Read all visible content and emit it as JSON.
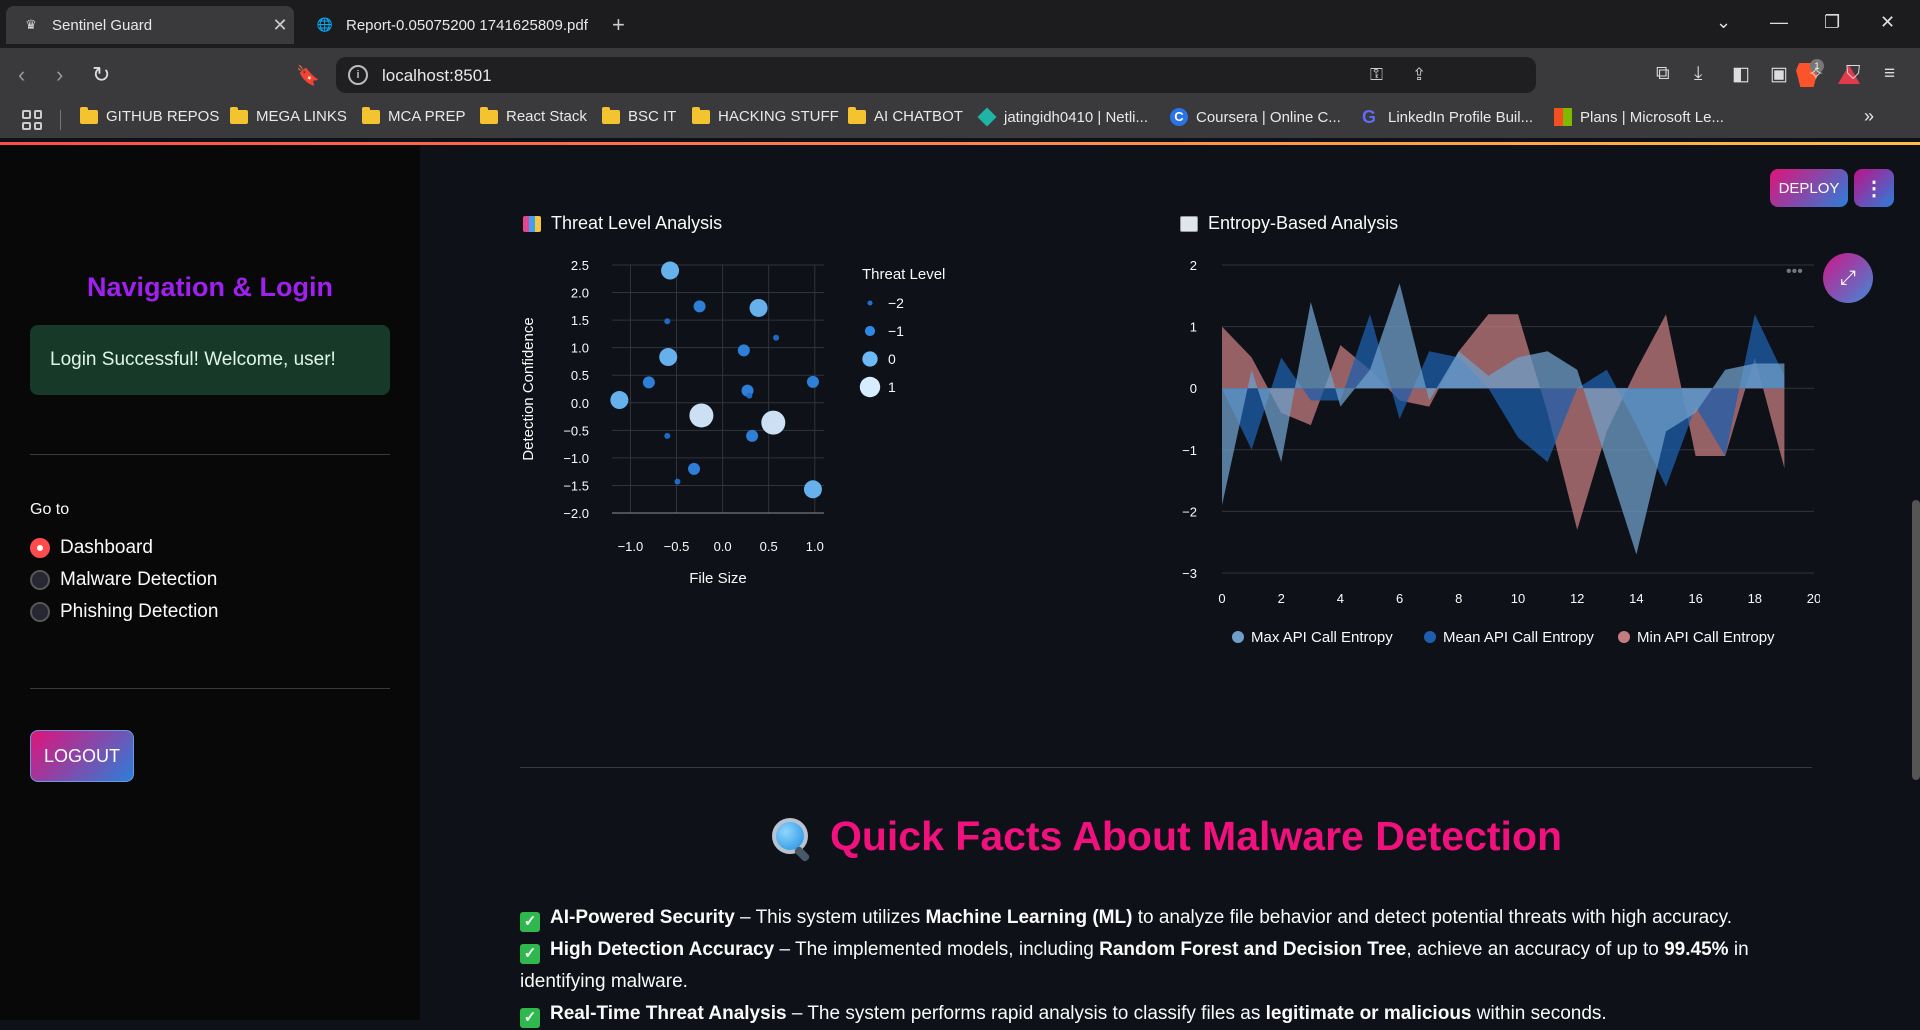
{
  "browser": {
    "tabs": [
      {
        "title": "Sentinel Guard",
        "icon": "crown-icon"
      },
      {
        "title": "Report-0.05075200 1741625809.pdf",
        "icon": "globe-icon"
      }
    ],
    "url": "localhost:8501",
    "brave_badge": "1",
    "bookmarks": [
      {
        "label": "GITHUB REPOS",
        "icon": "folder-icon"
      },
      {
        "label": "MEGA LINKS",
        "icon": "folder-icon"
      },
      {
        "label": "MCA PREP",
        "icon": "folder-icon"
      },
      {
        "label": "React Stack",
        "icon": "folder-icon"
      },
      {
        "label": "BSC IT",
        "icon": "folder-icon"
      },
      {
        "label": "HACKING STUFF",
        "icon": "folder-icon"
      },
      {
        "label": "AI CHATBOT",
        "icon": "folder-icon"
      },
      {
        "label": "jatingidh0410 | Netli...",
        "icon": "netlify-icon"
      },
      {
        "label": "Coursera | Online C...",
        "icon": "coursera-icon"
      },
      {
        "label": "LinkedIn Profile Buil...",
        "icon": "linkedin-builder-icon"
      },
      {
        "label": "Plans | Microsoft Le...",
        "icon": "microsoft-icon"
      }
    ]
  },
  "sidebar": {
    "title": "Navigation & Login",
    "login_message": "Login Successful! Welcome, user!",
    "goto_label": "Go to",
    "options": [
      "Dashboard",
      "Malware Detection",
      "Phishing Detection"
    ],
    "selected": "Dashboard",
    "logout_label": "LOGOUT"
  },
  "header": {
    "deploy_label": "DEPLOY",
    "menu_icon": "kebab-menu-icon"
  },
  "charts": {
    "threat_title": "Threat Level Analysis",
    "entropy_title": "Entropy-Based Analysis"
  },
  "chart_data": [
    {
      "type": "scatter",
      "title": "Threat Level Analysis",
      "xlabel": "File Size",
      "ylabel": "Detection Confidence",
      "xlim": [
        -1.2,
        1.1
      ],
      "ylim": [
        -2.0,
        2.5
      ],
      "xticks": [
        "−1.0",
        "−0.5",
        "0.0",
        "0.5",
        "1.0"
      ],
      "yticks": [
        "2.5",
        "2.0",
        "1.5",
        "1.0",
        "0.5",
        "0.0",
        "−0.5",
        "−1.0",
        "−1.5",
        "−2.0"
      ],
      "legend_title": "Threat Level",
      "legend": [
        "−2",
        "−1",
        "0",
        "1"
      ],
      "colors": {
        "-2": "#1f6fcf",
        "-1": "#2f86e3",
        "0": "#6cb9f7",
        "1": "#d6ecff"
      },
      "points": [
        {
          "x": -0.57,
          "y": 2.4,
          "level": 0
        },
        {
          "x": -0.25,
          "y": 1.75,
          "level": -1
        },
        {
          "x": 0.39,
          "y": 1.72,
          "level": 0
        },
        {
          "x": -0.6,
          "y": 1.48,
          "level": -2
        },
        {
          "x": 0.58,
          "y": 1.18,
          "level": -2
        },
        {
          "x": 0.23,
          "y": 0.95,
          "level": -1
        },
        {
          "x": -0.59,
          "y": 0.83,
          "level": 0
        },
        {
          "x": -0.8,
          "y": 0.37,
          "level": -1
        },
        {
          "x": 0.98,
          "y": 0.38,
          "level": -1
        },
        {
          "x": 0.27,
          "y": 0.22,
          "level": -1
        },
        {
          "x": 0.29,
          "y": 0.13,
          "level": -2
        },
        {
          "x": -1.12,
          "y": 0.05,
          "level": 0
        },
        {
          "x": -0.23,
          "y": -0.23,
          "level": 1
        },
        {
          "x": 0.55,
          "y": -0.36,
          "level": 1
        },
        {
          "x": -0.6,
          "y": -0.6,
          "level": -2
        },
        {
          "x": 0.32,
          "y": -0.6,
          "level": -1
        },
        {
          "x": -0.31,
          "y": -1.2,
          "level": -1
        },
        {
          "x": -0.49,
          "y": -1.43,
          "level": -2
        },
        {
          "x": 0.98,
          "y": -1.57,
          "level": 0
        }
      ]
    },
    {
      "type": "area",
      "title": "Entropy-Based Analysis",
      "x": [
        0,
        1,
        2,
        3,
        4,
        5,
        6,
        7,
        8,
        9,
        10,
        11,
        12,
        13,
        14,
        15,
        16,
        17,
        18,
        19
      ],
      "xticks": [
        "0",
        "2",
        "4",
        "6",
        "8",
        "10",
        "12",
        "14",
        "16",
        "18",
        "20"
      ],
      "yticks": [
        "2",
        "1",
        "0",
        "−1",
        "−2",
        "−3"
      ],
      "ylim": [
        -3,
        2
      ],
      "xlim": [
        0,
        20
      ],
      "series": [
        {
          "name": "Max API Call Entropy",
          "color": "#6f9fc9",
          "values": [
            -1.9,
            0.3,
            -1.2,
            1.4,
            -0.3,
            0.3,
            1.7,
            -0.2,
            0.6,
            0.2,
            0.5,
            0.6,
            0.3,
            -1.2,
            -2.7,
            -0.7,
            -0.4,
            0.3,
            0.4,
            0.4
          ]
        },
        {
          "name": "Mean API Call Entropy",
          "color": "#1d5fae",
          "values": [
            0.0,
            -1.0,
            0.5,
            -0.2,
            -0.2,
            1.2,
            -0.5,
            0.6,
            0.5,
            0.0,
            -0.8,
            -1.2,
            0.0,
            0.3,
            -0.6,
            -1.6,
            -0.3,
            -1.1,
            1.2,
            0.2
          ]
        },
        {
          "name": "Min API Call Entropy",
          "color": "#c47c80",
          "values": [
            1.0,
            0.5,
            -0.4,
            -0.6,
            0.7,
            0.3,
            -0.2,
            -0.3,
            0.6,
            1.2,
            1.2,
            -0.4,
            -2.3,
            -0.7,
            0.3,
            1.2,
            -1.1,
            -1.1,
            0.5,
            -1.3
          ]
        }
      ]
    }
  ],
  "facts": {
    "title": "Quick Facts About Malware Detection",
    "items": [
      {
        "bold": "AI-Powered Security",
        "t1": " – This system utilizes ",
        "b2": "Machine Learning (ML)",
        "t2": " to analyze file behavior and detect potential threats with high accuracy."
      },
      {
        "bold": "High Detection Accuracy",
        "t1": " – The implemented models, including ",
        "b2": "Random Forest and Decision Tree",
        "t2": ", achieve an accuracy of up to ",
        "b3": "99.45%",
        "t3": " in identifying malware."
      },
      {
        "bold": "Real-Time Threat Analysis",
        "t1": " – The system performs rapid analysis to classify files as ",
        "b2": "legitimate or malicious",
        "t2": " within seconds."
      }
    ]
  }
}
